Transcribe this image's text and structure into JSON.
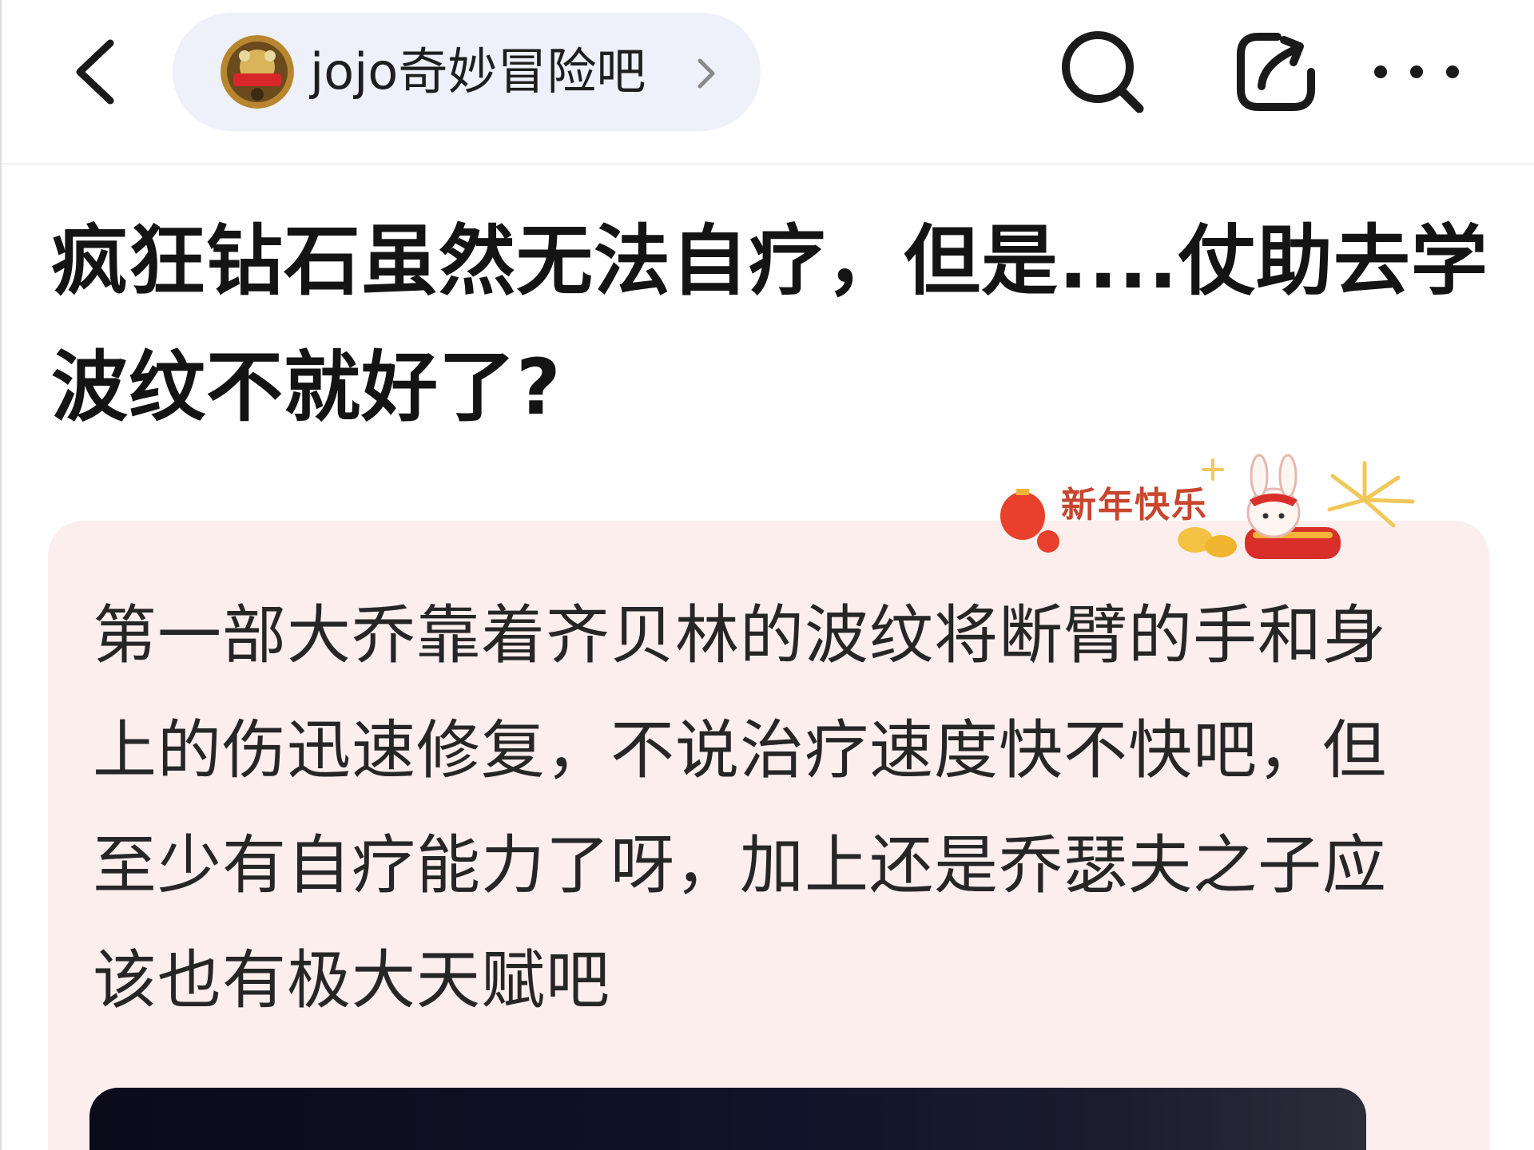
{
  "nav": {
    "forum_name": "jojo奇妙冒险吧",
    "icons": {
      "back": "chevron-left-icon",
      "search": "search-icon",
      "share": "share-icon",
      "more": "more-horizontal-icon",
      "forum_arrow": "chevron-right-icon"
    }
  },
  "post": {
    "title": "疯狂钻石虽然无法自疗，但是....仗助去学波纹不就好了?",
    "body": "第一部大乔靠着齐贝林的波纹将断臂的手和身上的伤迅速修复，不说治疗速度快不快吧，但至少有自疗能力了呀，加上还是乔瑟夫之子应该也有极大天赋吧",
    "decoration_text": "新年快乐"
  },
  "colors": {
    "card_background": "#fdeeee",
    "forum_pill_background": "#eef0fa",
    "festival_red": "#c8452e"
  }
}
